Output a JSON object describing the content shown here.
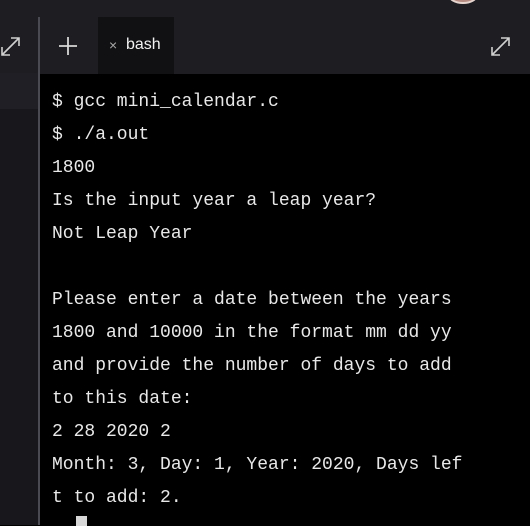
{
  "tab": {
    "label": "bash",
    "close_glyph": "×"
  },
  "icons": {
    "new_tab": "plus-icon",
    "close_tab": "close-icon",
    "expand_left": "expand-icon",
    "expand_right": "expand-icon",
    "avatar": "avatar"
  },
  "colors": {
    "terminal_bg": "#000000",
    "tabbar_bg": "#1d1d22",
    "active_tab_bg": "#111114",
    "text": "#e8e8e8"
  },
  "terminal": {
    "lines": [
      "$ gcc mini_calendar.c",
      "$ ./a.out",
      "1800",
      "Is the input year a leap year?",
      "Not Leap Year",
      "",
      "Please enter a date between the years",
      "1800 and 10000 in the format mm dd yy",
      "and provide the number of days to add",
      "to this date:",
      "2 28 2020 2",
      "Month: 3, Day: 1, Year: 2020, Days lef",
      "t to add: 2."
    ]
  }
}
